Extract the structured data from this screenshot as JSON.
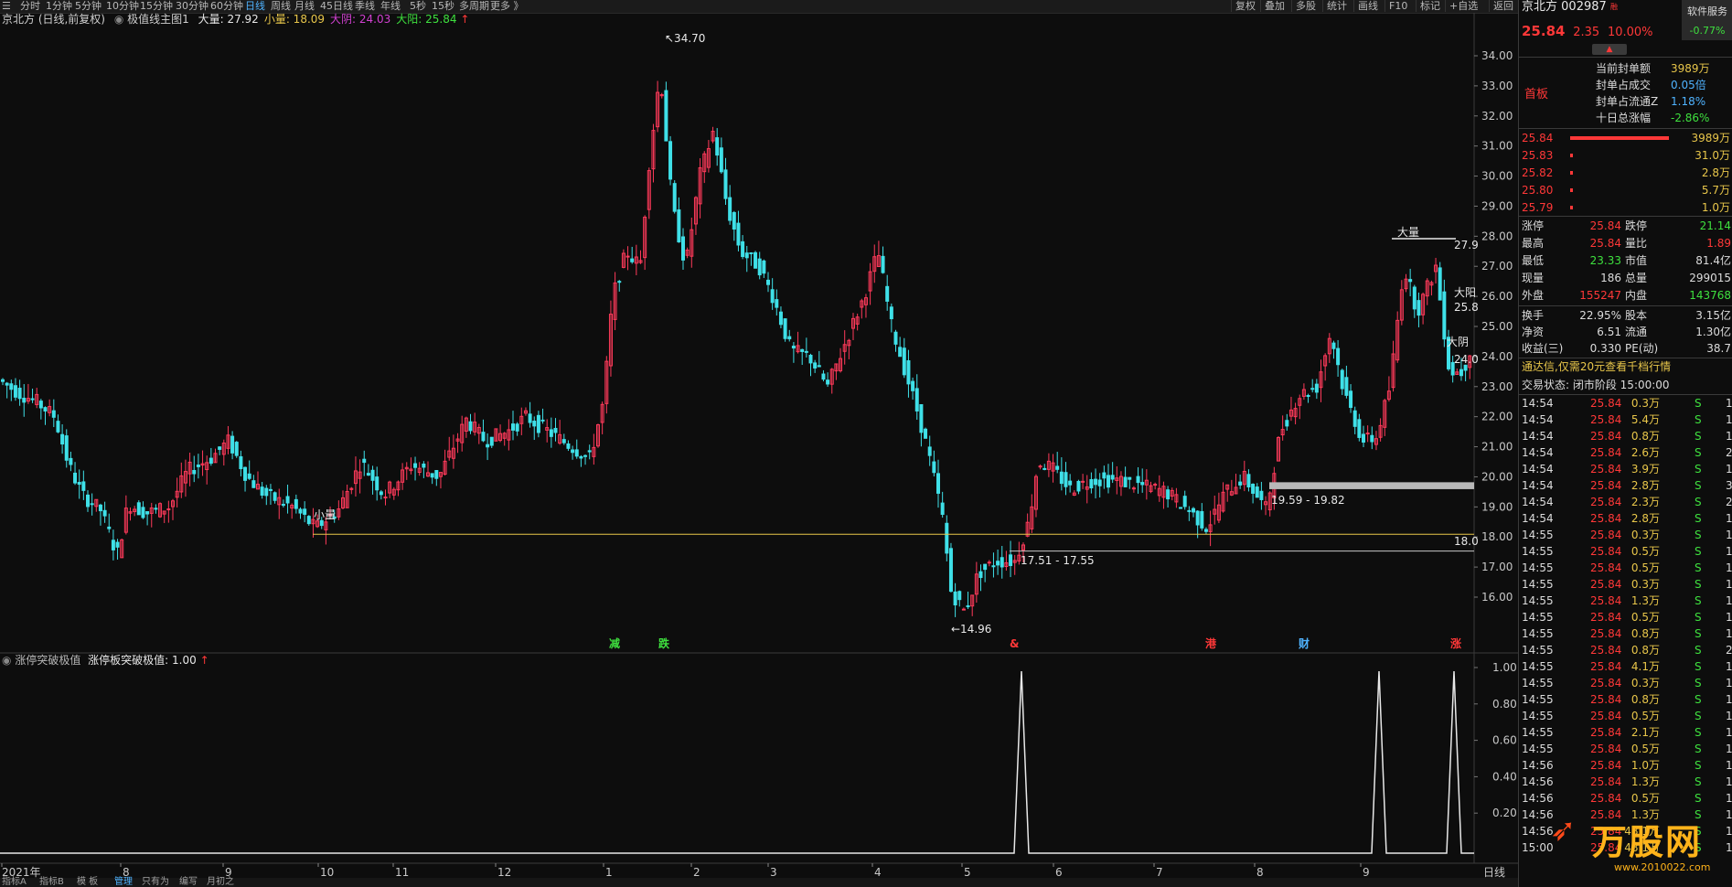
{
  "toolbar": {
    "timeframes": [
      "分时",
      "1分钟",
      "5分钟",
      "10分钟",
      "15分钟",
      "30分钟",
      "60分钟",
      "日线",
      "周线",
      "月线",
      "45日线",
      "季线",
      "年线",
      "5秒",
      "15秒",
      "多周期",
      "更多 》"
    ],
    "active_timeframe": "日线",
    "right_buttons": [
      "复权",
      "叠加",
      "多股",
      "统计",
      "画线",
      "F10",
      "标记",
      "+自选",
      "返回"
    ]
  },
  "main_chart": {
    "title": "京北方 (日线,前复权)",
    "indicator_name": "极值线主图1",
    "legend": [
      {
        "label": "大量: 27.92",
        "color": "#e8e8e8"
      },
      {
        "label": "小量: 18.09",
        "color": "#e8c64a"
      },
      {
        "label": "大阴: 24.03",
        "color": "#d040d0"
      },
      {
        "label": "大阳: 25.84",
        "color": "#3ee03e"
      }
    ],
    "legend_arrow": "↑",
    "high_label": "34.70",
    "low_label": "14.96",
    "zone_label_1": "17.51 - 17.55",
    "zone_label_2": "19.59 - 19.82",
    "tag_small_vol": "小量",
    "tag_big_vol": "大量",
    "tag_big_yang": "大阳",
    "tag_big_yin": "大阴",
    "right_val_big_vol": "27.9",
    "right_val_big_yang": "25.8",
    "right_val_big_yin": "24.0",
    "right_val_small_vol": "18.0",
    "event_markers": [
      {
        "text": "减",
        "color": "#3ee03e"
      },
      {
        "text": "跌",
        "color": "#3ee03e"
      },
      {
        "text": "&",
        "color": "#ff3838"
      },
      {
        "text": "港",
        "color": "#ff3838"
      },
      {
        "text": "财",
        "color": "#4fb3ff"
      },
      {
        "text": "涨",
        "color": "#ff3838"
      }
    ],
    "y_ticks": [
      "34.00",
      "33.00",
      "32.00",
      "31.00",
      "30.00",
      "29.00",
      "28.00",
      "27.00",
      "26.00",
      "25.00",
      "24.00",
      "23.00",
      "22.00",
      "21.00",
      "20.00",
      "19.00",
      "18.00",
      "17.00",
      "16.00"
    ]
  },
  "sub_chart": {
    "indicator_name": "涨停突破极值",
    "legend": "涨停板突破极值: 1.00",
    "legend_arrow": "↑",
    "y_ticks": [
      "1.00",
      "0.80",
      "0.60",
      "0.40",
      "0.20"
    ]
  },
  "x_axis": {
    "labels": [
      "2021年",
      "8",
      "9",
      "10",
      "11",
      "12",
      "1",
      "2",
      "3",
      "4",
      "5",
      "6",
      "7",
      "8",
      "9"
    ],
    "period_label": "日线"
  },
  "bottom_tabs": [
    "指标A",
    "指标B",
    "模 板",
    "管理",
    "只有为",
    "编写",
    "月初之"
  ],
  "right_panel": {
    "name": "京北方",
    "code": "002987",
    "price": "25.84",
    "change": "2.35",
    "pct": "10.00%",
    "service": "软件服务",
    "service_pct": "-0.77%",
    "first_board": "首板",
    "seal_info": [
      {
        "label": "当前封单额",
        "value": "3989万",
        "vcolor": "#e8c64a"
      },
      {
        "label": "封单占成交",
        "value": "0.05倍",
        "vcolor": "#4fb3ff"
      },
      {
        "label": "封单占流通Z",
        "value": "1.18%",
        "vcolor": "#4fb3ff"
      },
      {
        "label": "十日总涨幅",
        "value": "-2.86%",
        "vcolor": "#3ee03e"
      }
    ],
    "order_book": [
      {
        "price": "25.84",
        "vol": "3989万",
        "bar": 0.9
      },
      {
        "price": "25.83",
        "vol": "31.0万",
        "bar": 0.02
      },
      {
        "price": "25.82",
        "vol": "2.8万",
        "bar": 0.02
      },
      {
        "price": "25.80",
        "vol": "5.7万",
        "bar": 0.02
      },
      {
        "price": "25.79",
        "vol": "1.0万",
        "bar": 0.02
      }
    ],
    "stats": [
      {
        "l1": "涨停",
        "v1": "25.84",
        "c1": "#ff3838",
        "l2": "跌停",
        "v2": "21.14",
        "c2": "#3ee03e"
      },
      {
        "l1": "最高",
        "v1": "25.84",
        "c1": "#ff3838",
        "l2": "量比",
        "v2": "1.89",
        "c2": "#ff3838"
      },
      {
        "l1": "最低",
        "v1": "23.33",
        "c1": "#3ee03e",
        "l2": "市值",
        "v2": "81.4亿",
        "c2": "#dcdcdc"
      },
      {
        "l1": "现量",
        "v1": "186",
        "c1": "#dcdcdc",
        "l2": "总量",
        "v2": "299015",
        "c2": "#dcdcdc"
      },
      {
        "l1": "外盘",
        "v1": "155247",
        "c1": "#ff3838",
        "l2": "内盘",
        "v2": "143768",
        "c2": "#3ee03e"
      }
    ],
    "stats2": [
      {
        "l1": "换手",
        "v1": "22.95%",
        "l2": "股本",
        "v2": "3.15亿"
      },
      {
        "l1": "净资",
        "v1": "6.51",
        "l2": "流通",
        "v2": "1.30亿"
      },
      {
        "l1": "收益(三)",
        "v1": "0.330",
        "l2": "PE(动)",
        "v2": "38.7"
      }
    ],
    "ad": "通达信,仅需20元查看千档行情",
    "trade_status": "交易状态: 闭市阶段 15:00:00",
    "ticks": [
      [
        "14:54",
        "25.84",
        "0.3万",
        "S",
        "1"
      ],
      [
        "14:54",
        "25.84",
        "5.4万",
        "S",
        "1"
      ],
      [
        "14:54",
        "25.84",
        "0.8万",
        "S",
        "1"
      ],
      [
        "14:54",
        "25.84",
        "2.6万",
        "S",
        "2"
      ],
      [
        "14:54",
        "25.84",
        "3.9万",
        "S",
        "1"
      ],
      [
        "14:54",
        "25.84",
        "2.8万",
        "S",
        "3"
      ],
      [
        "14:54",
        "25.84",
        "2.3万",
        "S",
        "2"
      ],
      [
        "14:54",
        "25.84",
        "2.8万",
        "S",
        "1"
      ],
      [
        "14:55",
        "25.84",
        "0.3万",
        "S",
        "1"
      ],
      [
        "14:55",
        "25.84",
        "0.5万",
        "S",
        "1"
      ],
      [
        "14:55",
        "25.84",
        "0.5万",
        "S",
        "1"
      ],
      [
        "14:55",
        "25.84",
        "0.3万",
        "S",
        "1"
      ],
      [
        "14:55",
        "25.84",
        "1.3万",
        "S",
        "1"
      ],
      [
        "14:55",
        "25.84",
        "0.5万",
        "S",
        "1"
      ],
      [
        "14:55",
        "25.84",
        "0.8万",
        "S",
        "1"
      ],
      [
        "14:55",
        "25.84",
        "0.8万",
        "S",
        "2"
      ],
      [
        "14:55",
        "25.84",
        "4.1万",
        "S",
        "1"
      ],
      [
        "14:55",
        "25.84",
        "0.3万",
        "S",
        "1"
      ],
      [
        "14:55",
        "25.84",
        "0.8万",
        "S",
        "1"
      ],
      [
        "14:55",
        "25.84",
        "0.5万",
        "S",
        "1"
      ],
      [
        "14:55",
        "25.84",
        "2.1万",
        "S",
        "1"
      ],
      [
        "14:55",
        "25.84",
        "0.5万",
        "S",
        "1"
      ],
      [
        "14:56",
        "25.84",
        "1.0万",
        "S",
        "1"
      ],
      [
        "14:56",
        "25.84",
        "1.3万",
        "S",
        "1"
      ],
      [
        "14:56",
        "25.84",
        "0.5万",
        "S",
        "1"
      ],
      [
        "14:56",
        "25.84",
        "1.3万",
        "S",
        "1"
      ],
      [
        "14:56",
        "25.84",
        "48.1万",
        "S",
        "1"
      ],
      [
        "15:00",
        "25.84",
        "48.1万",
        "S",
        "1"
      ]
    ],
    "watermark": "万股网",
    "watermark_url": "www.2010022.com"
  }
}
